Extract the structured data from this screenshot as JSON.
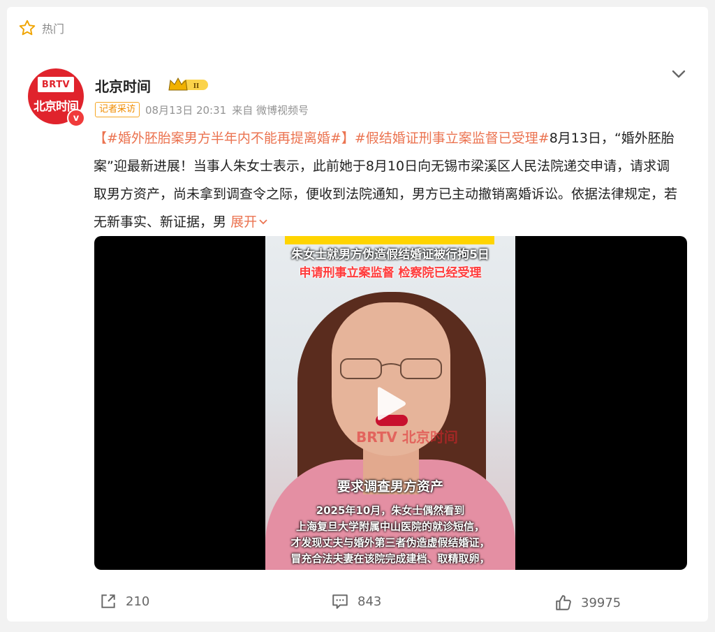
{
  "header": {
    "hot_label": "热门"
  },
  "post": {
    "avatar_top": "BRTV",
    "avatar_bottom": "北京时间",
    "verified_mark": "v",
    "username": "北京时间",
    "rank_badge": "II",
    "tag": "记者采访",
    "time": "08月13日 20:31",
    "source": "来自 微博视频号",
    "text": {
      "hashtag1": "【#婚外胚胎案男方半年内不能再提离婚#】",
      "hashtag2": "#假结婚证刑事立案监督已受理#",
      "body": "8月13日，“婚外胚胎案”迎最新进展！当事人朱女士表示，此前她于8月10日向无锡市梁溪区人民法院递交申请，请求调取男方资产，尚未拿到调查令之际，便收到法院通知，男方已主动撤销离婚诉讼。依据法律规定，若无新事实、新证据，男",
      "expand": "展开"
    }
  },
  "video": {
    "caption_top": "朱女士就男方伪造假结婚证被行拘5日",
    "caption_red": "申请刑事立案监督 检察院已经受理",
    "watermark": "BRTV 北京时间",
    "caption_mid": "要求调查男方资产",
    "caption_lines": [
      "2025年10月，朱女士偶然看到",
      "上海复旦大学附属中山医院的就诊短信，",
      "才发现丈夫与婚外第三者伪造虚假结婚证，",
      "冒充合法夫妻在该院完成建档、取精取卵，"
    ]
  },
  "actions": {
    "share_count": "210",
    "comment_count": "843",
    "like_count": "39975"
  },
  "colors": {
    "hashtag": "#eb7350",
    "brand": "#e0232c",
    "tag": "#f08c00"
  }
}
